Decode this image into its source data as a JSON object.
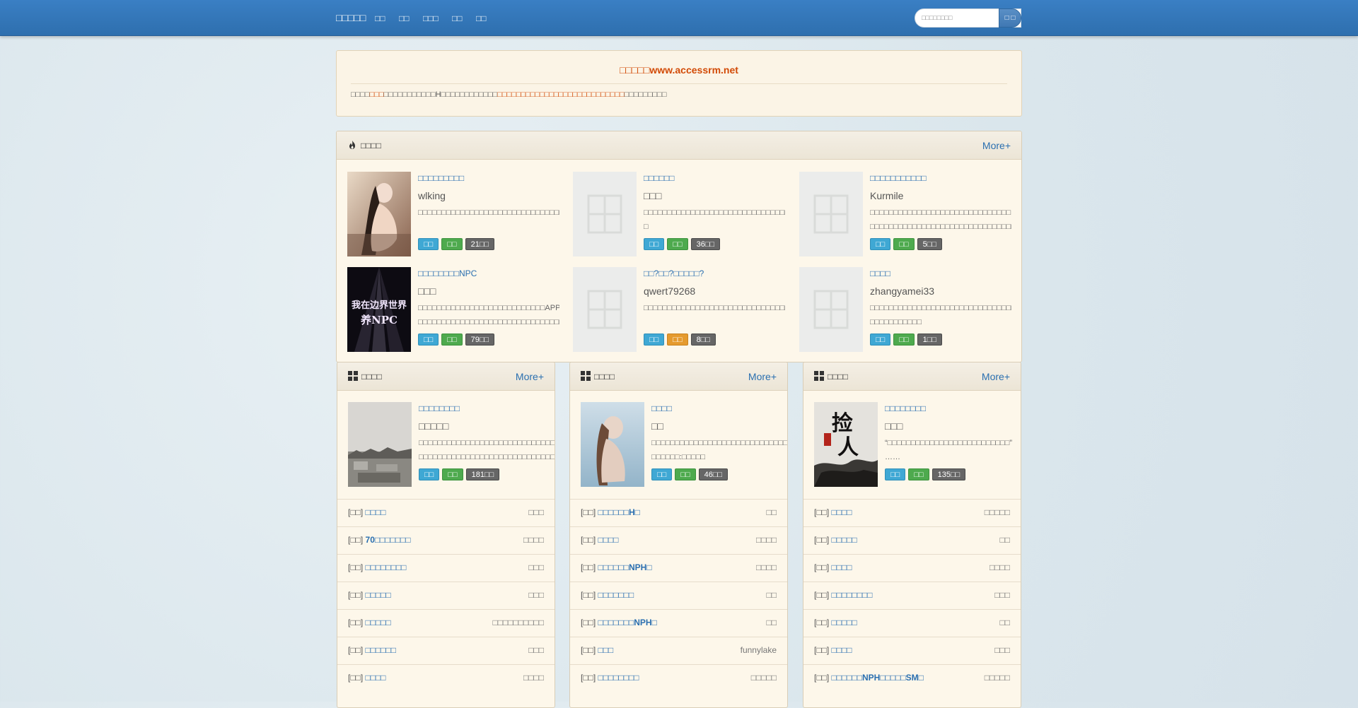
{
  "nav": {
    "brand": "□□□□□",
    "links": [
      "□□",
      "□□",
      "□□□",
      "□□",
      "□□"
    ],
    "search_placeholder": "□□□□□□□□",
    "search_button": "□ □"
  },
  "notice": {
    "title": "□□□□□www.accessrm.net",
    "body_a": "□□□□",
    "body_b": "□□□",
    "body_c": "□□□□□□□□□□□H□□□□□□□□□□□□",
    "body_d": "□□□□□□□□□□□□□□□□□□□□□□□□□□□",
    "body_e": "□□□□□□□□□"
  },
  "hot": {
    "title": "□□□□",
    "more": "More+",
    "books": [
      {
        "title": "□□□□□□□□□",
        "author": "wlking",
        "desc": "□□□□□□□□□□□□□□□□□□□□□□□□□□□□□□□□□□□□□□□□□□□txt□□□□□",
        "tags": [
          "□□",
          "□□",
          "21□□"
        ],
        "cover": "photo-figure"
      },
      {
        "title": "□□□□□□",
        "author": "□□□",
        "desc": "□□□□□□□□□□□□□□□□□□□□□□□□□□□□□□□□□□□□□□□□□□□□□□□□□□□□□□□□□□□□□□□□□□□□□□ □",
        "tags": [
          "□□",
          "□□",
          "36□□"
        ],
        "cover": "placeholder"
      },
      {
        "title": "□□□□□□□□□□□",
        "author": "Kurmile",
        "desc": "□□□□□□□□□□□□□□□□□□□□□□□□□□□□□□ □□□□□□□□□□□□□□□□□□□□□□□□□□□□□□□□□ □□□□□□□□□□□□□□□□□□□□",
        "tags": [
          "□□",
          "□□",
          "5□□"
        ],
        "cover": "placeholder"
      },
      {
        "title": "□□□□□□□□NPC",
        "author": "□□□",
        "desc": "□□□□□□□□□□□□□□□□□□□□□□□□□□□APP□□□□□□□□□□□□□□□□□□□□□□□□□ □□□□□□□□□□□□□□□□□□□□□□□□□□□□□□□",
        "tags": [
          "□□",
          "□□",
          "79□□"
        ],
        "cover": "npc"
      },
      {
        "title": "□□?□□?□□□□□?",
        "author": "qwert79268",
        "desc": "□□□□□□□□□□□□□□□□□□□□□□□□□□□□□□□□□□□□□□□□□□□□□□□□□□□□□□□□□□□□□□□□□□□□□□□□",
        "tags": [
          "□□",
          "□□",
          "8□□"
        ],
        "tag_colors": [
          "blue",
          "orange",
          "gray"
        ],
        "cover": "placeholder"
      },
      {
        "title": "□□□□",
        "author": "zhangyamei33",
        "desc": "□□□□□□□□□□□□□□□□□□□□□□□□□□□□□□□□□□□□ □□□□□□□□□□□ □□□□□□□□□□□□□□□□□□□□□□□□□□□□□——□□□",
        "tags": [
          "□□",
          "□□",
          "1□□"
        ],
        "cover": "placeholder"
      }
    ]
  },
  "columns": [
    {
      "title": "□□□□",
      "more": "More+",
      "feature": {
        "title": "□□□□□□□□",
        "author": "□□□□□",
        "desc": "□□□□□□□□□□□□□□□□□□□□□□□□□□□□□□□□□□□□□□□□□ □□□□□□□□□□□□□□□□□□□□□□□□□□□□□□□□□□",
        "tags": [
          "□□",
          "□□",
          "181□□"
        ],
        "cover": "city"
      },
      "rows": [
        {
          "cat": "[□□]",
          "name": "□□□□",
          "auth": "□□□"
        },
        {
          "cat": "[□□]",
          "name": "70□□□□□□□",
          "auth": "□□□□"
        },
        {
          "cat": "[□□]",
          "name": "□□□□□□□□",
          "auth": "□□□"
        },
        {
          "cat": "[□□]",
          "name": "□□□□□",
          "auth": "□□□"
        },
        {
          "cat": "[□□]",
          "name": "□□□□□",
          "auth": "□□□□□□□□□□"
        },
        {
          "cat": "[□□]",
          "name": "□□□□□□",
          "auth": "□□□"
        },
        {
          "cat": "[□□]",
          "name": "□□□□",
          "auth": "□□□□"
        }
      ]
    },
    {
      "title": "□□□□",
      "more": "More+",
      "feature": {
        "title": "□□□□",
        "author": "□□",
        "desc": "□□□□□□□□□□□□□□□□□□□□□□□□□□□□□□□□□□□□□□□□□□□□□□□□□□□□□□□□□□□□□……□□□□□□:□□□□□",
        "tags": [
          "□□",
          "□□",
          "46□□"
        ],
        "cover": "photo-blue"
      },
      "rows": [
        {
          "cat": "[□□]",
          "name": "□□□□□□H□",
          "auth": "□□"
        },
        {
          "cat": "[□□]",
          "name": "□□□□",
          "auth": "□□□□"
        },
        {
          "cat": "[□□]",
          "name": "□□□□□□NPH□",
          "auth": "□□□□"
        },
        {
          "cat": "[□□]",
          "name": "□□□□□□□",
          "auth": "□□"
        },
        {
          "cat": "[□□]",
          "name": "□□□□□□□NPH□",
          "auth": "□□"
        },
        {
          "cat": "[□□]",
          "name": "□□□",
          "auth": "funnylake"
        },
        {
          "cat": "[□□]",
          "name": "□□□□□□□□",
          "auth": "□□□□□"
        }
      ]
    },
    {
      "title": "□□□□",
      "more": "More+",
      "feature": {
        "title": "□□□□□□□□",
        "author": "□□□",
        "desc": "“□□□□□□□□□□□□□□□□□□□□□□□□□□” …… □□□□□□□□□□□□□□□□□□□□□□□□□□□□□□□□□□□□□□□□□□□□□□□□□□□□ □□□□□□",
        "tags": [
          "□□",
          "□□",
          "135□□"
        ],
        "cover": "ink"
      },
      "rows": [
        {
          "cat": "[□□]",
          "name": "□□□□",
          "auth": "□□□□□"
        },
        {
          "cat": "[□□]",
          "name": "□□□□□",
          "auth": "□□"
        },
        {
          "cat": "[□□]",
          "name": "□□□□",
          "auth": "□□□□"
        },
        {
          "cat": "[□□]",
          "name": "□□□□□□□□",
          "auth": "□□□"
        },
        {
          "cat": "[□□]",
          "name": "□□□□□",
          "auth": "□□"
        },
        {
          "cat": "[□□]",
          "name": "□□□□",
          "auth": "□□□"
        },
        {
          "cat": "[□□]",
          "name": "□□□□□□NPH□□□□□SM□",
          "auth": "□□□□□"
        }
      ]
    }
  ],
  "colors": {
    "nav": "#3a7fc4",
    "accent": "#d24a06",
    "link": "#2a6fb0"
  }
}
